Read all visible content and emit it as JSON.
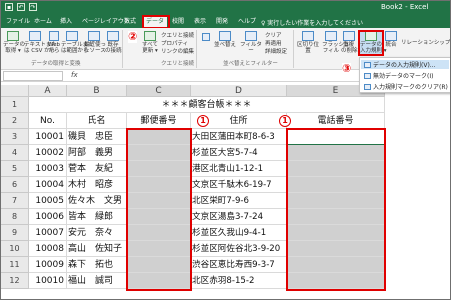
{
  "window": {
    "title": "Book2 - Excel",
    "save_icon": "save-icon",
    "undo_icon": "undo-icon",
    "redo_icon": "redo-icon"
  },
  "tabs": [
    "ファイル",
    "ホーム",
    "挿入",
    "ページレイアウト",
    "数式",
    "データ",
    "校閲",
    "表示",
    "開発",
    "ヘルプ"
  ],
  "active_tab": "データ",
  "search": "♀ 実行したい作業を入力してください",
  "ribbon": {
    "get_data": "データの\n取得 ▾",
    "from_text": "テキストまた\nは CSV から",
    "from_web": "Web\nから",
    "from_table": "テーブルまた\nは範囲から",
    "recent": "最近使っ\nたソース",
    "existing": "既存\nの接続",
    "refresh_all": "すべて\n更新 ▾",
    "queries": "クエリと接続",
    "properties": "プロパティ",
    "edit_links": "リンクの編集",
    "group_get": "データの取得と変換",
    "group_query": "クエリと接続",
    "sort": "並べ替え",
    "filter": "フィルター",
    "clear": "クリア",
    "reapply": "再適用",
    "advanced": "詳細設定",
    "group_sort": "並べ替えとフィルター",
    "text_to_col": "区切り位置",
    "flash_fill": "フラッシュ\nフィル",
    "remove_dup": "重複\nの削除",
    "validation": "データの\n入力規則 ▾",
    "consolidate": "統合",
    "relationships": "リレーションシップ"
  },
  "dropdown": {
    "item1": "データの入力規則(V)...",
    "item2": "無効データのマーク(I)",
    "item3": "入力規則マークのクリア(R)"
  },
  "markers": {
    "m2": "②",
    "m3": "③",
    "m1a": "1",
    "m1b": "1"
  },
  "columns": [
    "A",
    "B",
    "C",
    "D",
    "E"
  ],
  "row_numbers": [
    "1",
    "2",
    "3",
    "4",
    "5",
    "6",
    "7",
    "8",
    "9",
    "10",
    "11",
    "12"
  ],
  "sheet": {
    "title": "＊＊＊顧客台帳＊＊＊",
    "headers": [
      "No.",
      "氏名",
      "郵便番号",
      "住所",
      "電話番号"
    ],
    "rows": [
      {
        "no": "10001",
        "name": "磯貝　忠臣",
        "addr": "大田区蒲田本町8-6-3"
      },
      {
        "no": "10002",
        "name": "阿部　義男",
        "addr": "杉並区大宮5-7-4"
      },
      {
        "no": "10003",
        "name": "菅本　友紀",
        "addr": "港区北青山1-12-1"
      },
      {
        "no": "10004",
        "name": "木村　昭彦",
        "addr": "文京区千駄木6-19-7"
      },
      {
        "no": "10005",
        "name": "佐々木　文男",
        "addr": "北区栄町7-9-6"
      },
      {
        "no": "10006",
        "name": "皆本　緑郎",
        "addr": "文京区湯島3-7-24"
      },
      {
        "no": "10007",
        "name": "安元　奈々",
        "addr": "杉並区久我山9-4-1"
      },
      {
        "no": "10008",
        "name": "高山　佐知子",
        "addr": "杉並区阿佐谷北3-9-20"
      },
      {
        "no": "10009",
        "name": "森下　拓也",
        "addr": "渋谷区恵比寿西9-3-7"
      },
      {
        "no": "10010",
        "name": "福山　誠司",
        "addr": "北区赤羽8-15-2"
      }
    ]
  }
}
